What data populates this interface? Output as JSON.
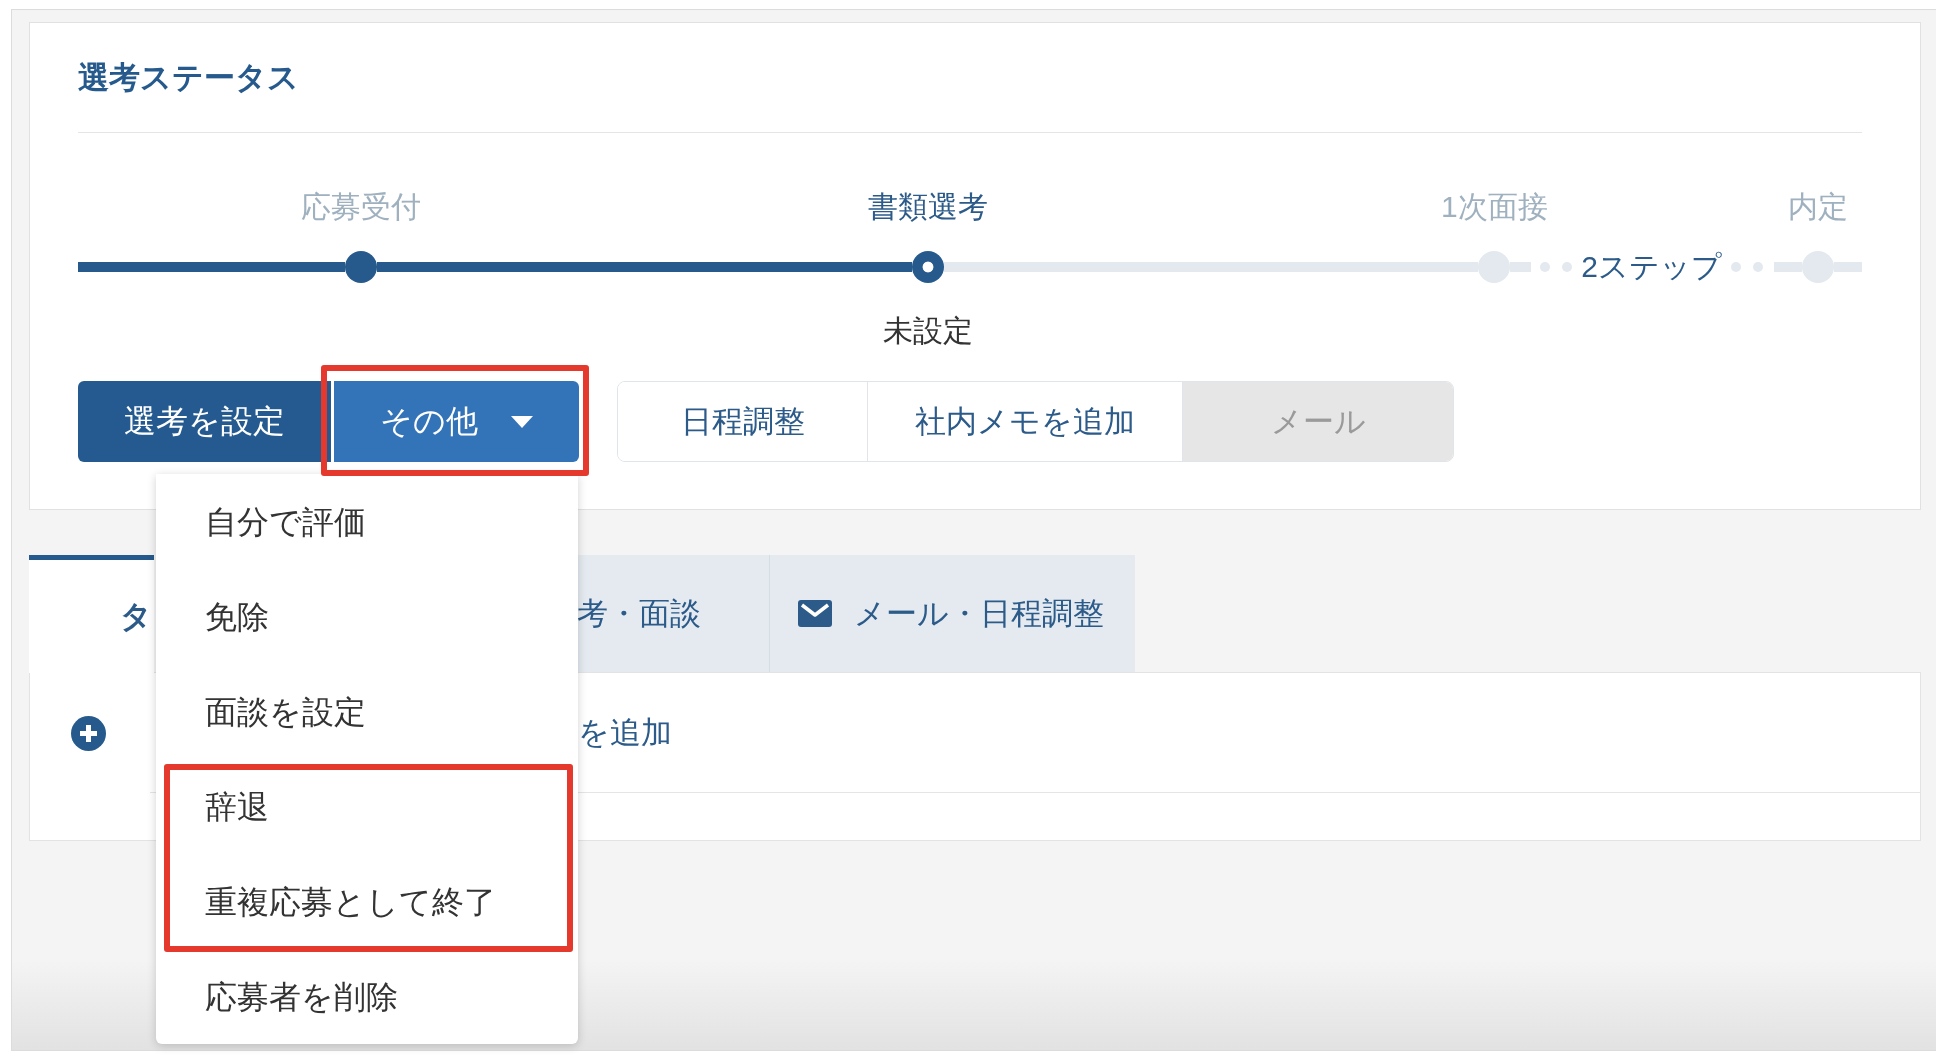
{
  "status_card": {
    "title": "選考ステータス",
    "steps": [
      {
        "kind": "step",
        "label": "応募受付",
        "done": true,
        "selected": false
      },
      {
        "kind": "step",
        "label": "書類選考",
        "done": false,
        "selected": true,
        "note": "未設定"
      },
      {
        "kind": "step",
        "label": "1次面接",
        "done": false,
        "selected": false
      },
      {
        "kind": "collapsed",
        "label": "2ステップ"
      },
      {
        "kind": "step",
        "label": "内定",
        "done": false,
        "selected": false
      }
    ],
    "primary_actions": [
      {
        "kind": "button",
        "label": "選考を設定"
      },
      {
        "kind": "dropdown",
        "label": "その他",
        "highlighted": true,
        "expanded": true,
        "menu_items": [
          {
            "label": "自分で評価"
          },
          {
            "label": "免除"
          },
          {
            "label": "面談を設定"
          },
          {
            "label": "辞退",
            "highlighted": true
          },
          {
            "label": "重複応募として終了",
            "highlighted": true
          },
          {
            "label": "応募者を削除"
          }
        ]
      }
    ],
    "secondary_actions": [
      {
        "label": "日程調整",
        "disabled": false
      },
      {
        "label": "社内メモを追加",
        "disabled": false
      },
      {
        "label": "メール",
        "disabled": true
      }
    ]
  },
  "tabs": [
    {
      "label": "タ",
      "selected": true,
      "icon": false
    },
    {
      "label": "考・面談",
      "selected": false,
      "icon": false
    },
    {
      "label": "メール・日程調整",
      "selected": false,
      "icon": true
    }
  ],
  "tab_panel": {
    "add_link": "を追加"
  }
}
